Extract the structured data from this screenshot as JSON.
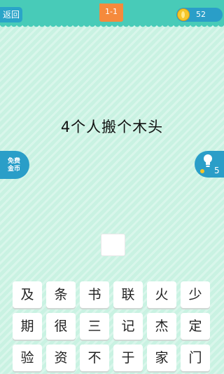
{
  "header": {
    "back_label": "返回",
    "level_label": "1-1",
    "coin_count": "52"
  },
  "question": "4个人搬个木头",
  "free_coins": {
    "line1": "免费",
    "line2": "金币"
  },
  "hint": {
    "count": "5"
  },
  "answer": {
    "slots": 1
  },
  "keyboard": {
    "rows": [
      [
        "及",
        "条",
        "书",
        "联",
        "火",
        "少"
      ],
      [
        "期",
        "很",
        "三",
        "记",
        "杰",
        "定"
      ],
      [
        "验",
        "资",
        "不",
        "于",
        "家",
        "门"
      ]
    ]
  }
}
